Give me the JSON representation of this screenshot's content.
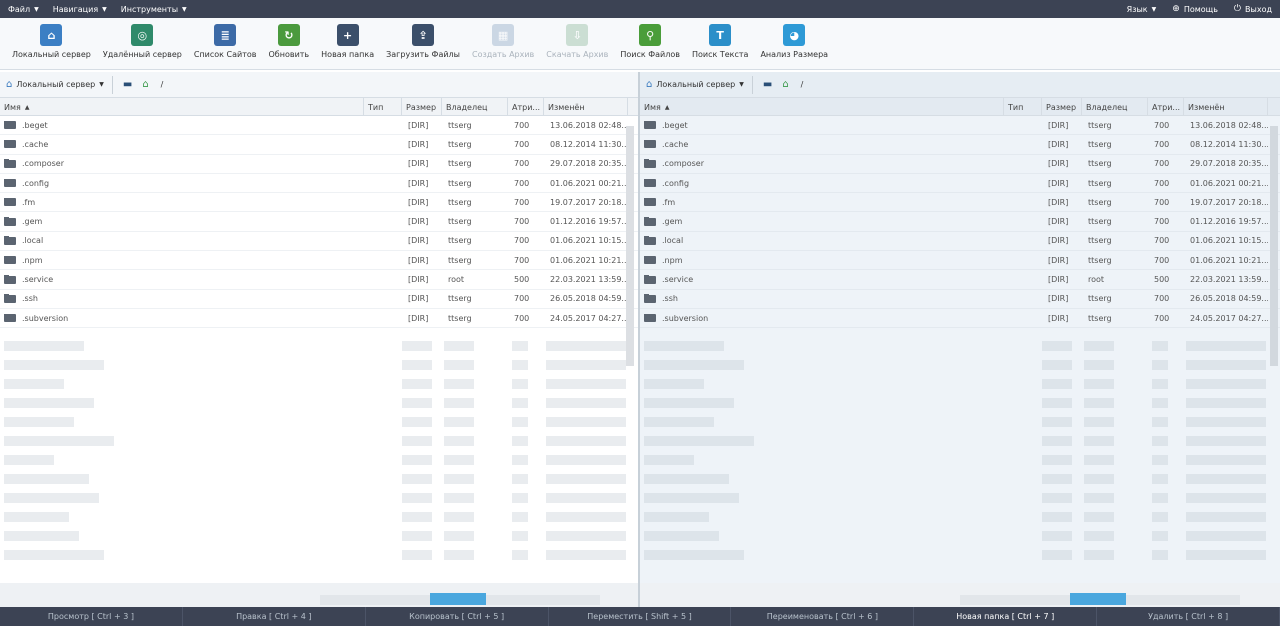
{
  "menubar": {
    "file": "Файл",
    "navigation": "Навигация",
    "tools": "Инструменты",
    "language": "Язык",
    "help": "Помощь",
    "logout": "Выход"
  },
  "toolbar": {
    "items": [
      {
        "label": "Локальный сервер",
        "icon": "home-icon",
        "color": "#3b7fc4",
        "disabled": false
      },
      {
        "label": "Удалённый сервер",
        "icon": "remote-server-icon",
        "color": "#2f8a6a",
        "disabled": false
      },
      {
        "label": "Список Сайтов",
        "icon": "sites-list-icon",
        "color": "#3c6aa6",
        "disabled": false
      },
      {
        "label": "Обновить",
        "icon": "refresh-icon",
        "color": "#4b9a3e",
        "disabled": false
      },
      {
        "label": "Новая папка",
        "icon": "new-folder-icon",
        "color": "#3b4f6a",
        "disabled": false
      },
      {
        "label": "Загрузить Файлы",
        "icon": "upload-icon",
        "color": "#3b4f6a",
        "disabled": false
      },
      {
        "label": "Создать Архив",
        "icon": "create-archive-icon",
        "color": "#8aa5c2",
        "disabled": true
      },
      {
        "label": "Скачать Архив",
        "icon": "download-archive-icon",
        "color": "#8ab79a",
        "disabled": true
      },
      {
        "label": "Поиск Файлов",
        "icon": "search-files-icon",
        "color": "#4a9d3a",
        "disabled": false
      },
      {
        "label": "Поиск Текста",
        "icon": "search-text-icon",
        "color": "#2b8fc9",
        "disabled": false
      },
      {
        "label": "Анализ Размера",
        "icon": "size-analysis-icon",
        "color": "#2e9ad6",
        "disabled": false
      }
    ]
  },
  "panel": {
    "server": "Локальный сервер",
    "path": "/",
    "columns": {
      "name": "Имя",
      "type": "Тип",
      "size": "Размер",
      "owner": "Владелец",
      "attr": "Атри...",
      "modified": "Изменён"
    }
  },
  "files": [
    {
      "name": ".beget",
      "size": "[DIR]",
      "owner": "ttserg",
      "attr": "700",
      "modified": "13.06.2018 02:48..."
    },
    {
      "name": ".cache",
      "size": "[DIR]",
      "owner": "ttserg",
      "attr": "700",
      "modified": "08.12.2014 11:30..."
    },
    {
      "name": ".composer",
      "size": "[DIR]",
      "owner": "ttserg",
      "attr": "700",
      "modified": "29.07.2018 20:35..."
    },
    {
      "name": ".config",
      "size": "[DIR]",
      "owner": "ttserg",
      "attr": "700",
      "modified": "01.06.2021 00:21..."
    },
    {
      "name": ".fm",
      "size": "[DIR]",
      "owner": "ttserg",
      "attr": "700",
      "modified": "19.07.2017 20:18..."
    },
    {
      "name": ".gem",
      "size": "[DIR]",
      "owner": "ttserg",
      "attr": "700",
      "modified": "01.12.2016 19:57..."
    },
    {
      "name": ".local",
      "size": "[DIR]",
      "owner": "ttserg",
      "attr": "700",
      "modified": "01.06.2021 10:15..."
    },
    {
      "name": ".npm",
      "size": "[DIR]",
      "owner": "ttserg",
      "attr": "700",
      "modified": "01.06.2021 10:21..."
    },
    {
      "name": ".service",
      "size": "[DIR]",
      "owner": "root",
      "attr": "500",
      "modified": "22.03.2021 13:59..."
    },
    {
      "name": ".ssh",
      "size": "[DIR]",
      "owner": "ttserg",
      "attr": "700",
      "modified": "26.05.2018 04:59..."
    },
    {
      "name": ".subversion",
      "size": "[DIR]",
      "owner": "ttserg",
      "attr": "700",
      "modified": "24.05.2017 04:27..."
    }
  ],
  "bottombar": {
    "items": [
      {
        "label": "Просмотр [ Ctrl + 3 ]",
        "active": false
      },
      {
        "label": "Правка [ Ctrl + 4 ]",
        "active": false
      },
      {
        "label": "Копировать [ Ctrl + 5 ]",
        "active": false
      },
      {
        "label": "Переместить [ Shift + 5 ]",
        "active": false
      },
      {
        "label": "Переименовать [ Ctrl + 6 ]",
        "active": false
      },
      {
        "label": "Новая папка [ Ctrl + 7 ]",
        "active": true
      },
      {
        "label": "Удалить [ Ctrl + 8 ]",
        "active": false
      }
    ]
  }
}
